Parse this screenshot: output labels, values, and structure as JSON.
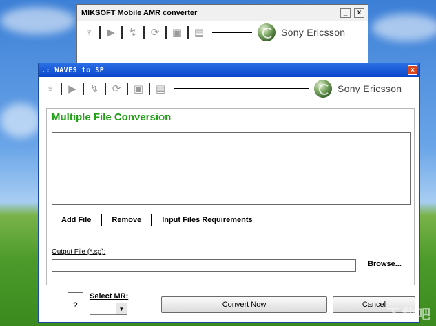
{
  "back_window": {
    "title": "MIKSOFT Mobile AMR converter",
    "minimize": "_",
    "close": "x",
    "brand": "Sony Ericsson"
  },
  "front_window": {
    "title": ".: WAVES to SP",
    "close": "×",
    "brand": "Sony Ericsson",
    "panel_title": "Multiple File Conversion",
    "actions": {
      "add": "Add File",
      "remove": "Remove",
      "requirements": "Input Files Requirements"
    },
    "output": {
      "label": "Output File (*.sp):",
      "value": "",
      "browse": "Browse..."
    },
    "help": "?",
    "select_mr": {
      "label": "Select MR:",
      "value": ""
    },
    "convert": "Convert Now",
    "cancel": "Cancel"
  },
  "toolbar_icons": [
    "ear-icon",
    "play-icon",
    "signal-icon",
    "refresh-icon",
    "phone-icon",
    "device-icon"
  ],
  "watermark": "下载吧"
}
